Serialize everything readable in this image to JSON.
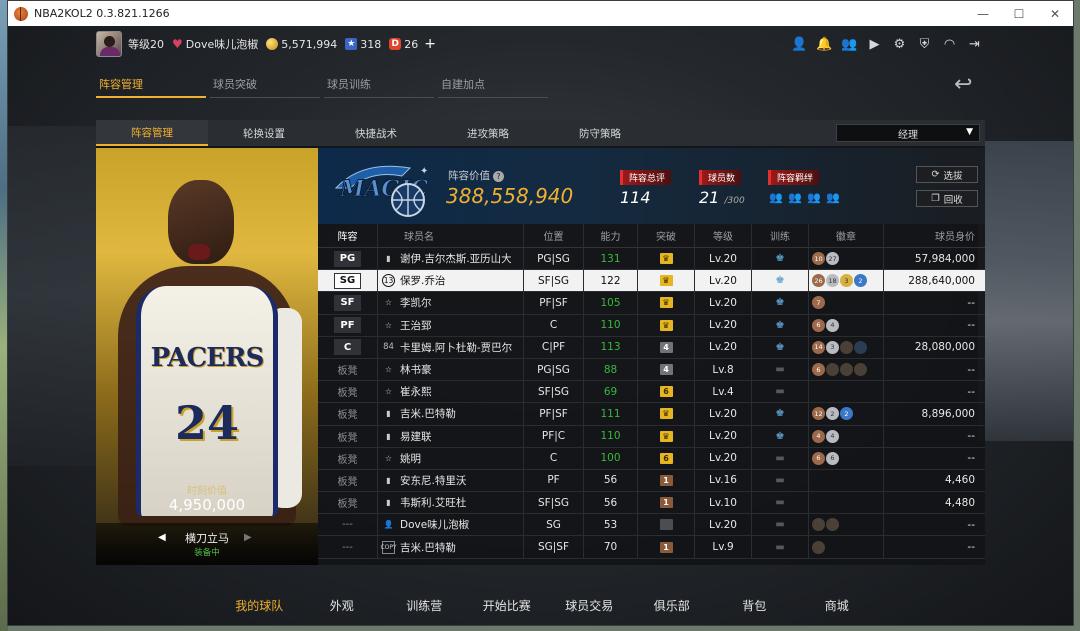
{
  "window": {
    "title": "NBA2KOL2 0.3.821.1266"
  },
  "topbar": {
    "level": "等级20",
    "username": "Dove味儿泡椒",
    "gold": "5,571,994",
    "star_points": "318",
    "tickets": "26",
    "plus": "+"
  },
  "nav_tabs": [
    "阵容管理",
    "球员突破",
    "球员训练",
    "自建加点"
  ],
  "sub_tabs": [
    "阵容管理",
    "轮换设置",
    "快捷战术",
    "进攻策略",
    "防守策略"
  ],
  "manager_select": {
    "value": "经理"
  },
  "player_card": {
    "jersey_text": "PACERS",
    "jersey_number": "24",
    "value_label": "时刻价值",
    "value": "4,950,000",
    "skill": "横刀立马",
    "status": "装备中"
  },
  "team": {
    "logo_text": "MAGIC",
    "value_label": "阵容价值",
    "value": "388,558,940",
    "overall_label": "阵容总评",
    "overall": "114",
    "count_label": "球员数",
    "count": "21",
    "count_max": "/300",
    "bonds_label": "阵容羁绊",
    "scout_label": "选拔",
    "recycle_label": "回收"
  },
  "table": {
    "headers": [
      "阵容",
      "球员名",
      "位置",
      "能力",
      "突破",
      "等级",
      "训练",
      "徽章",
      "球员身价"
    ],
    "rows": [
      {
        "slot": "PG",
        "tier": "bars",
        "name": "谢伊.吉尔杰斯.亚历山大",
        "position": "PG|SG",
        "rating": "131",
        "break": "gold",
        "level": "Lv.20",
        "train": true,
        "badges": [
          [
            "b",
            "10"
          ],
          [
            "s",
            "27"
          ]
        ],
        "worth": "57,984,000"
      },
      {
        "slot": "SG",
        "tier": "13",
        "name": "保罗.乔治",
        "position": "SF|SG",
        "rating": "122",
        "break": "gold",
        "level": "Lv.20",
        "train": true,
        "badges": [
          [
            "b",
            "26"
          ],
          [
            "s",
            "18"
          ],
          [
            "g",
            "3"
          ],
          [
            "bl",
            "2"
          ]
        ],
        "worth": "288,640,000"
      },
      {
        "slot": "SF",
        "tier": "star",
        "name": "李凯尔",
        "position": "PF|SF",
        "rating": "105",
        "break": "gold",
        "level": "Lv.20",
        "train": true,
        "badges": [
          [
            "b",
            "7"
          ]
        ],
        "worth": "--"
      },
      {
        "slot": "PF",
        "tier": "star",
        "name": "王治郅",
        "position": "C",
        "rating": "110",
        "break": "gold",
        "level": "Lv.20",
        "train": true,
        "badges": [
          [
            "b",
            "6"
          ],
          [
            "s",
            "4"
          ]
        ],
        "worth": "--"
      },
      {
        "slot": "C",
        "tier": "84",
        "name": "卡里姆.阿卜杜勒-贾巴尔",
        "position": "C|PF",
        "rating": "113",
        "break": "gray4",
        "level": "Lv.20",
        "train": true,
        "badges": [
          [
            "b",
            "14"
          ],
          [
            "s",
            "3"
          ],
          [
            "d",
            "0"
          ],
          [
            "dk",
            "0"
          ]
        ],
        "worth": "28,080,000"
      },
      {
        "slot": "板凳",
        "tier": "star",
        "name": "林书豪",
        "position": "PG|SG",
        "rating": "88",
        "break": "gray4",
        "level": "Lv.8",
        "train": false,
        "badges": [
          [
            "b",
            "6"
          ],
          [
            "d",
            "0"
          ],
          [
            "d",
            "0"
          ],
          [
            "d",
            "0"
          ]
        ],
        "worth": "--"
      },
      {
        "slot": "板凳",
        "tier": "star",
        "name": "崔永熙",
        "position": "SF|SG",
        "rating": "69",
        "break": "gold6",
        "level": "Lv.4",
        "train": false,
        "badges": [],
        "worth": "--"
      },
      {
        "slot": "板凳",
        "tier": "bars",
        "name": "吉米.巴特勒",
        "position": "PF|SF",
        "rating": "111",
        "break": "gold",
        "level": "Lv.20",
        "train": true,
        "badges": [
          [
            "b",
            "12"
          ],
          [
            "s",
            "2"
          ],
          [
            "bl",
            "2"
          ]
        ],
        "worth": "8,896,000"
      },
      {
        "slot": "板凳",
        "tier": "bars",
        "name": "易建联",
        "position": "PF|C",
        "rating": "110",
        "break": "gold",
        "level": "Lv.20",
        "train": true,
        "badges": [
          [
            "b",
            "4"
          ],
          [
            "s",
            "4"
          ]
        ],
        "worth": "--"
      },
      {
        "slot": "板凳",
        "tier": "star",
        "name": "姚明",
        "position": "C",
        "rating": "100",
        "break": "gold6",
        "level": "Lv.20",
        "train": false,
        "badges": [
          [
            "b",
            "6"
          ],
          [
            "s",
            "6"
          ]
        ],
        "worth": "--"
      },
      {
        "slot": "板凳",
        "tier": "bars",
        "name": "安东尼.特里沃",
        "position": "PF",
        "rating": "56",
        "break": "bronze1",
        "level": "Lv.16",
        "train": false,
        "badges": [],
        "worth": "4,460"
      },
      {
        "slot": "板凳",
        "tier": "bars",
        "name": "韦斯利.艾旺杜",
        "position": "SF|SG",
        "rating": "56",
        "break": "bronze1",
        "level": "Lv.10",
        "train": false,
        "badges": [],
        "worth": "4,480"
      },
      {
        "slot": "---",
        "tier": "person",
        "name": "Dove味儿泡椒",
        "position": "SG",
        "rating": "53",
        "break": "dim",
        "level": "Lv.20",
        "train": false,
        "badges": [
          [
            "d",
            "0"
          ],
          [
            "d",
            "0"
          ]
        ],
        "worth": "--"
      },
      {
        "slot": "---",
        "tier": "COPY",
        "name": "吉米.巴特勒",
        "position": "SG|SF",
        "rating": "70",
        "break": "bronze1",
        "level": "Lv.9",
        "train": false,
        "badges": [
          [
            "d",
            "0"
          ]
        ],
        "worth": "--"
      }
    ]
  },
  "bottom_nav": [
    "我的球队",
    "外观",
    "训练营",
    "开始比赛",
    "球员交易",
    "俱乐部",
    "背包",
    "商城"
  ],
  "colors": {
    "accent": "#f0b030",
    "rating_green": "#39b839",
    "tag_red": "#9a1a1a"
  }
}
